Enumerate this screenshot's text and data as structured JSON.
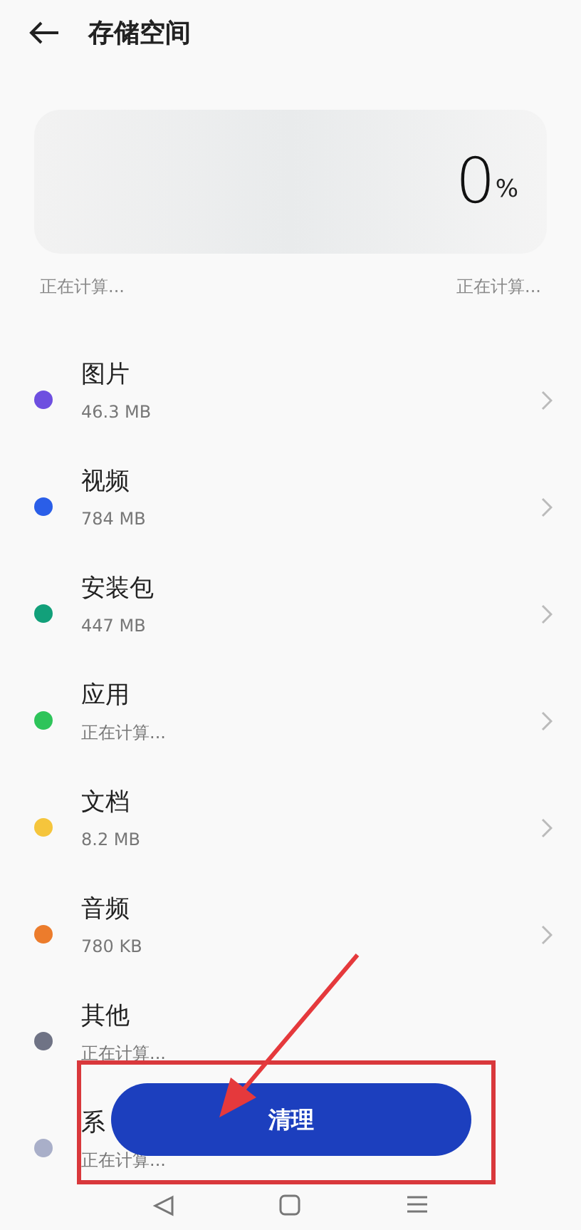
{
  "header": {
    "title": "存储空间"
  },
  "usage": {
    "percent": "0",
    "unit": "%",
    "left_caption": "正在计算...",
    "right_caption": "正在计算..."
  },
  "categories": [
    {
      "name": "图片",
      "size": "46.3 MB",
      "color": "#6e4fe0",
      "chevron": true
    },
    {
      "name": "视频",
      "size": "784 MB",
      "color": "#2a5ee8",
      "chevron": true
    },
    {
      "name": "安装包",
      "size": "447 MB",
      "color": "#12a07a",
      "chevron": true
    },
    {
      "name": "应用",
      "size": "正在计算...",
      "color": "#2ec45a",
      "chevron": true
    },
    {
      "name": "文档",
      "size": "8.2 MB",
      "color": "#f5c53c",
      "chevron": true
    },
    {
      "name": "音频",
      "size": "780 KB",
      "color": "#ec7c2c",
      "chevron": true
    },
    {
      "name": "其他",
      "size": "正在计算...",
      "color": "#6f7385",
      "chevron": false
    },
    {
      "name": "系",
      "size": "正在计算...",
      "color": "#a9afc9",
      "chevron": false
    }
  ],
  "clean_button": {
    "label": "清理"
  }
}
